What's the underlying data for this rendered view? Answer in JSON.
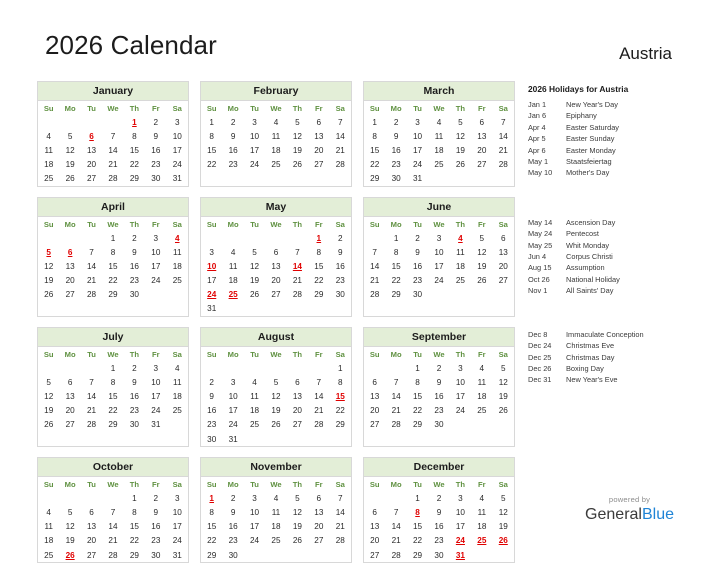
{
  "header": {
    "title": "2026 Calendar",
    "country": "Austria"
  },
  "weekdays": [
    "Su",
    "Mo",
    "Tu",
    "We",
    "Th",
    "Fr",
    "Sa"
  ],
  "months": [
    {
      "name": "January",
      "lead": 4,
      "days": 31,
      "holidays": [
        1,
        6
      ]
    },
    {
      "name": "February",
      "lead": 0,
      "days": 28,
      "holidays": []
    },
    {
      "name": "March",
      "lead": 0,
      "days": 31,
      "holidays": []
    },
    {
      "name": "April",
      "lead": 3,
      "days": 30,
      "holidays": [
        4,
        5,
        6
      ]
    },
    {
      "name": "May",
      "lead": 5,
      "days": 31,
      "holidays": [
        1,
        10,
        14,
        24,
        25
      ]
    },
    {
      "name": "June",
      "lead": 1,
      "days": 30,
      "holidays": [
        4
      ]
    },
    {
      "name": "July",
      "lead": 3,
      "days": 31,
      "holidays": []
    },
    {
      "name": "August",
      "lead": 6,
      "days": 31,
      "holidays": [
        15
      ]
    },
    {
      "name": "September",
      "lead": 2,
      "days": 30,
      "holidays": []
    },
    {
      "name": "October",
      "lead": 4,
      "days": 31,
      "holidays": [
        26
      ]
    },
    {
      "name": "November",
      "lead": 0,
      "days": 30,
      "holidays": [
        1
      ]
    },
    {
      "name": "December",
      "lead": 2,
      "days": 31,
      "holidays": [
        8,
        24,
        25,
        26,
        31
      ]
    }
  ],
  "holiday_panel": {
    "title": "2026 Holidays for Austria",
    "groups": [
      [
        {
          "date": "Jan 1",
          "name": "New Year's Day"
        },
        {
          "date": "Jan 6",
          "name": "Epiphany"
        },
        {
          "date": "Apr 4",
          "name": "Easter Saturday"
        },
        {
          "date": "Apr 5",
          "name": "Easter Sunday"
        },
        {
          "date": "Apr 6",
          "name": "Easter Monday"
        },
        {
          "date": "May 1",
          "name": "Staatsfeiertag"
        },
        {
          "date": "May 10",
          "name": "Mother's Day"
        }
      ],
      [
        {
          "date": "May 14",
          "name": "Ascension Day"
        },
        {
          "date": "May 24",
          "name": "Pentecost"
        },
        {
          "date": "May 25",
          "name": "Whit Monday"
        },
        {
          "date": "Jun 4",
          "name": "Corpus Christi"
        },
        {
          "date": "Aug 15",
          "name": "Assumption"
        },
        {
          "date": "Oct 26",
          "name": "National Holiday"
        },
        {
          "date": "Nov 1",
          "name": "All Saints' Day"
        }
      ],
      [
        {
          "date": "Dec 8",
          "name": "Immaculate Conception"
        },
        {
          "date": "Dec 24",
          "name": "Christmas Eve"
        },
        {
          "date": "Dec 25",
          "name": "Christmas Day"
        },
        {
          "date": "Dec 26",
          "name": "Boxing Day"
        },
        {
          "date": "Dec 31",
          "name": "New Year's Eve"
        }
      ]
    ]
  },
  "logo": {
    "sub": "powered by",
    "name_part1": "General",
    "name_part2": "Blue"
  },
  "colors": {
    "month_header_bg": "#e3eed7",
    "weekday_text": "#5f9140",
    "holiday_text": "#e00000",
    "logo_blue": "#1f84d6"
  }
}
